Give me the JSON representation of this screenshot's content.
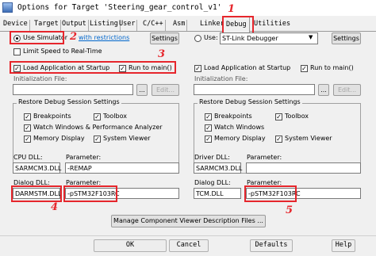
{
  "window": {
    "title": "Options for Target 'Steering_gear_control_v1'"
  },
  "tabs": [
    "Device",
    "Target",
    "Output",
    "Listing",
    "User",
    "C/C++",
    "Asm",
    "Linker",
    "Debug",
    "Utilities"
  ],
  "left": {
    "use_simulator": "Use Simulator",
    "restrictions_link": "with restrictions",
    "settings": "Settings",
    "limit_speed": "Limit Speed to Real-Time",
    "load_app": "Load Application at Startup",
    "run_to_main": "Run to main()",
    "init_file_label": "Initialization File:",
    "browse": "...",
    "edit": "Edit...",
    "restore_group": "Restore Debug Session Settings",
    "restore": [
      "Breakpoints",
      "Toolbox",
      "Watch Windows & Performance Analyzer",
      "Memory Display",
      "System Viewer"
    ],
    "cpu_dll_label": "CPU DLL:",
    "cpu_param_label": "Parameter:",
    "cpu_dll": "SARMCM3.DLL",
    "cpu_param": "-REMAP",
    "dialog_dll_label": "Dialog DLL:",
    "dialog_param_label": "Parameter:",
    "dialog_dll": "DARMSTM.DLL",
    "dialog_param": "-pSTM32F103RC"
  },
  "right": {
    "use": "Use:",
    "debugger": "ST-Link Debugger",
    "settings": "Settings",
    "load_app": "Load Application at Startup",
    "run_to_main": "Run to main()",
    "init_file_label": "Initialization File:",
    "browse": "...",
    "edit": "Edit...",
    "restore_group": "Restore Debug Session Settings",
    "restore": [
      "Breakpoints",
      "Toolbox",
      "Watch Windows",
      "Memory Display",
      "System Viewer"
    ],
    "driver_dll_label": "Driver DLL:",
    "driver_param_label": "Parameter:",
    "driver_dll": "SARMCM3.DLL",
    "driver_param": "",
    "dialog_dll_label": "Dialog DLL:",
    "dialog_param_label": "Parameter:",
    "dialog_dll": "TCM.DLL",
    "dialog_param": "-pSTM32F103RC"
  },
  "manage_button": "Manage Component Viewer Description Files ...",
  "buttons": {
    "ok": "OK",
    "cancel": "Cancel",
    "defaults": "Defaults",
    "help": "Help"
  },
  "annotations": [
    "1",
    "2",
    "3",
    "4",
    "5"
  ],
  "annotation_color": "#e6262c"
}
